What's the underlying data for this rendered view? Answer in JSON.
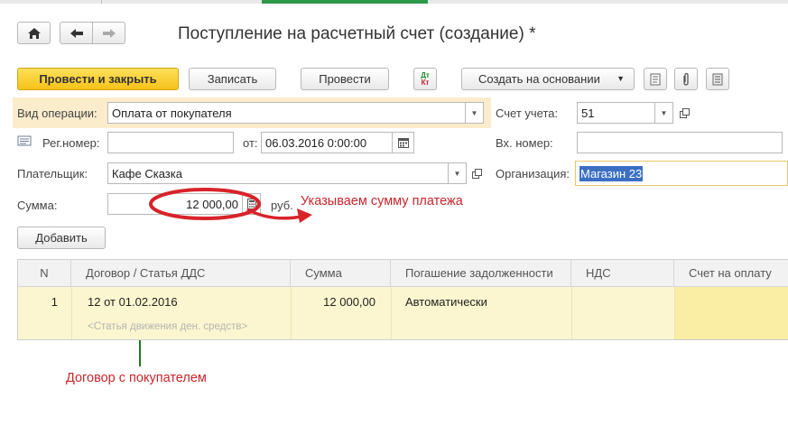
{
  "window": {
    "title": "Поступление на расчетный счет (создание) *"
  },
  "toolbar": {
    "post_close": "Провести и закрыть",
    "save": "Записать",
    "post": "Провести",
    "dt_kt_line1": "Дт",
    "dt_kt_line2": "Кт",
    "create_based": "Создать на основании"
  },
  "form": {
    "operation_label": "Вид операции:",
    "operation_value": "Оплата от покупателя",
    "account_label": "Счет учета:",
    "account_value": "51",
    "reg_label": "Рег.номер:",
    "reg_value": "",
    "date_label": "от:",
    "date_value": "06.03.2016  0:00:00",
    "in_number_label": "Вх. номер:",
    "in_number_value": "",
    "payer_label": "Плательщик:",
    "payer_value": "Кафе Сказка",
    "org_label": "Организация:",
    "org_value": "Магазин 23",
    "sum_label": "Сумма:",
    "sum_value": "12 000,00",
    "currency": "руб.",
    "add_button": "Добавить"
  },
  "table": {
    "columns": [
      "N",
      "Договор / Статья ДДС",
      "Сумма",
      "Погашение задолженности",
      "НДС",
      "Счет на оплату"
    ],
    "rows": [
      {
        "n": "1",
        "contract": "12 от 01.02.2016",
        "contract_placeholder": "<Статья движения ден. средств>",
        "sum": "12 000,00",
        "repayment": "Автоматически",
        "vat": "",
        "invoice": ""
      }
    ]
  },
  "annotations": {
    "sum_note": "Указываем сумму платежа",
    "contract_note": "Договор с покупателем"
  },
  "colors": {
    "primary_button": "#f5c21a",
    "annotation_red": "#c8262d",
    "annotation_green": "#1e7a1e",
    "row_yellow": "#fbf6cf",
    "selection_blue": "#3b6fc4"
  }
}
